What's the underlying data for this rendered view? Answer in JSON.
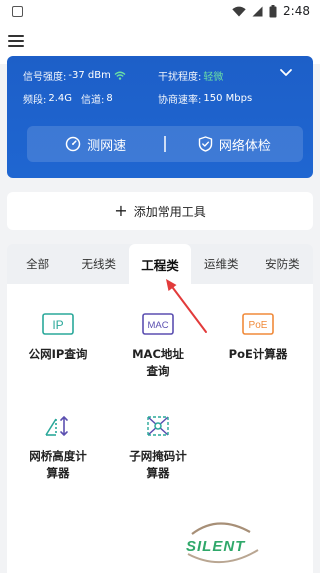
{
  "status_bar": {
    "time": "2:48"
  },
  "network": {
    "signal_label": "信号强度:",
    "signal_value": "-37 dBm",
    "interference_label": "干扰程度:",
    "interference_value": "轻微",
    "band_label": "频段:",
    "band_value": "2.4G",
    "channel_label": "信道:",
    "channel_value": "8",
    "rate_label": "协商速率:",
    "rate_value": "150 Mbps"
  },
  "actions": {
    "speed_test": "测网速",
    "network_check": "网络体检"
  },
  "add_tools": {
    "label": "添加常用工具"
  },
  "tabs": [
    "全部",
    "无线类",
    "工程类",
    "运维类",
    "安防类"
  ],
  "active_tab": "工程类",
  "tools": [
    {
      "label": "公网IP查询",
      "icon": "ip-icon",
      "badge": "IP"
    },
    {
      "label": "MAC地址\n查询",
      "icon": "mac-icon",
      "badge": "MAC"
    },
    {
      "label": "PoE计算器",
      "icon": "poe-icon",
      "badge": "PoE"
    },
    {
      "label": "网桥高度计\n算器",
      "icon": "bridge-height-icon"
    },
    {
      "label": "子网掩码计\n算器",
      "icon": "subnet-mask-icon"
    }
  ],
  "watermark": {
    "text": "SILENT"
  },
  "colors": {
    "primary_blue": "#1f63cd",
    "accent_green": "#6be0a4",
    "teal": "#2aa89a",
    "purple": "#5b4fb0",
    "orange": "#f08a3a"
  }
}
